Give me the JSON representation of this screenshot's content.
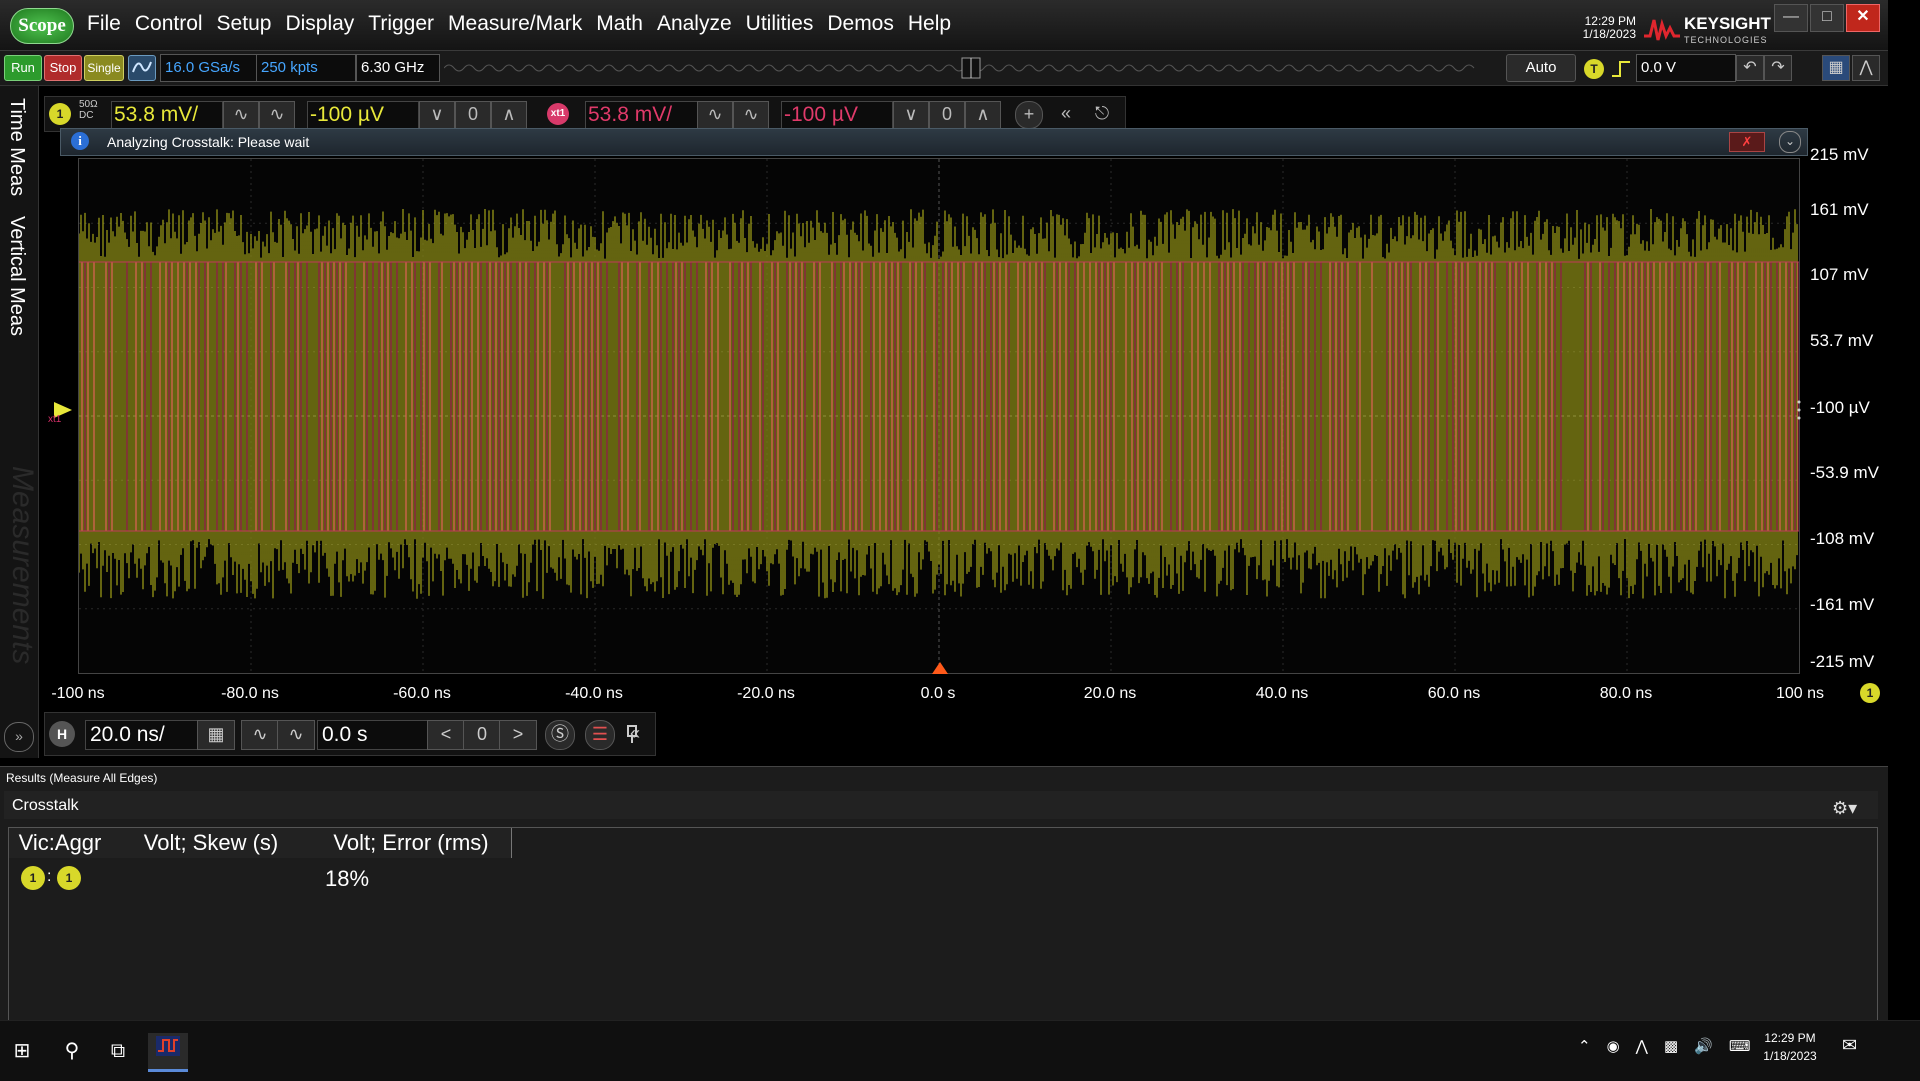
{
  "app": {
    "scope_button": "Scope",
    "menu": [
      "File",
      "Control",
      "Setup",
      "Display",
      "Trigger",
      "Measure/Mark",
      "Math",
      "Analyze",
      "Utilities",
      "Demos",
      "Help"
    ],
    "time": "12:29 PM",
    "date": "1/18/2023",
    "brand": "KEYSIGHT",
    "brand_sub": "TECHNOLOGIES"
  },
  "toolbar": {
    "run": "Run",
    "stop": "Stop",
    "single": "Single",
    "sample_rate": "16.0 GSa/s",
    "memory_depth": "250 kpts",
    "bandwidth": "6.30 GHz",
    "trigger_mode": "Auto",
    "trigger_badge": "T",
    "trigger_level": "0.0 V"
  },
  "left_tabs": [
    "Time Meas",
    "Vertical Meas",
    "Measurements"
  ],
  "channels": {
    "ch1": {
      "badge": "1",
      "impedance": "50Ω",
      "coupling": "DC",
      "scale": "53.8 mV/",
      "offset": "-100 µV"
    },
    "xt1": {
      "badge": "xt1",
      "scale": "53.8 mV/",
      "offset": "-100 µV"
    }
  },
  "info_bar": {
    "text": "Analyzing Crosstalk: Please wait"
  },
  "waveform": {
    "y_labels": [
      "215 mV",
      "161 mV",
      "107 mV",
      "53.7 mV",
      "-100 µV",
      "-53.9 mV",
      "-108 mV",
      "-161 mV",
      "-215 mV"
    ],
    "x_labels": [
      "-100 ns",
      "-80.0 ns",
      "-60.0 ns",
      "-40.0 ns",
      "-20.0 ns",
      "0.0 s",
      "20.0 ns",
      "40.0 ns",
      "60.0 ns",
      "80.0 ns",
      "100 ns"
    ],
    "x_badge": "1",
    "ch1_color": "#d8d820",
    "xt1_color": "#d8306a"
  },
  "horizontal": {
    "badge": "H",
    "scale": "20.0 ns/",
    "position": "0.0 s"
  },
  "results": {
    "header": "Results   (Measure All Edges)",
    "panel_title": "Crosstalk",
    "columns": [
      "Vic:Aggr",
      "Volt; Skew (s)",
      "Volt; Error (rms)"
    ],
    "rows": [
      {
        "victim": "1",
        "aggressor": "1",
        "skew": "",
        "error": "18%"
      }
    ]
  },
  "taskbar": {
    "time": "12:29 PM",
    "date": "1/18/2023"
  }
}
